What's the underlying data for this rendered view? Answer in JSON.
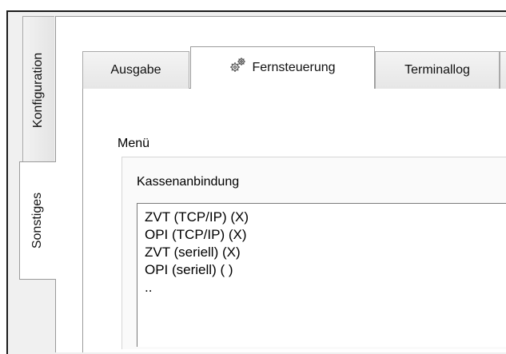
{
  "side_tabs": [
    {
      "label": "Konfiguration",
      "selected": false
    },
    {
      "label": "Sonstiges",
      "selected": true
    }
  ],
  "top_tabs": [
    {
      "label": "Ausgabe",
      "selected": false
    },
    {
      "label": "Fernsteuerung",
      "selected": true,
      "icon": "gears-icon"
    },
    {
      "label": "Terminallog",
      "selected": false
    }
  ],
  "menu_label": "Menü",
  "group": {
    "label": "Kassenanbindung",
    "items": [
      "ZVT (TCP/IP) (X)",
      "OPI (TCP/IP) (X)",
      "ZVT (seriell) (X)",
      "OPI (seriell) ( )",
      ".."
    ]
  }
}
